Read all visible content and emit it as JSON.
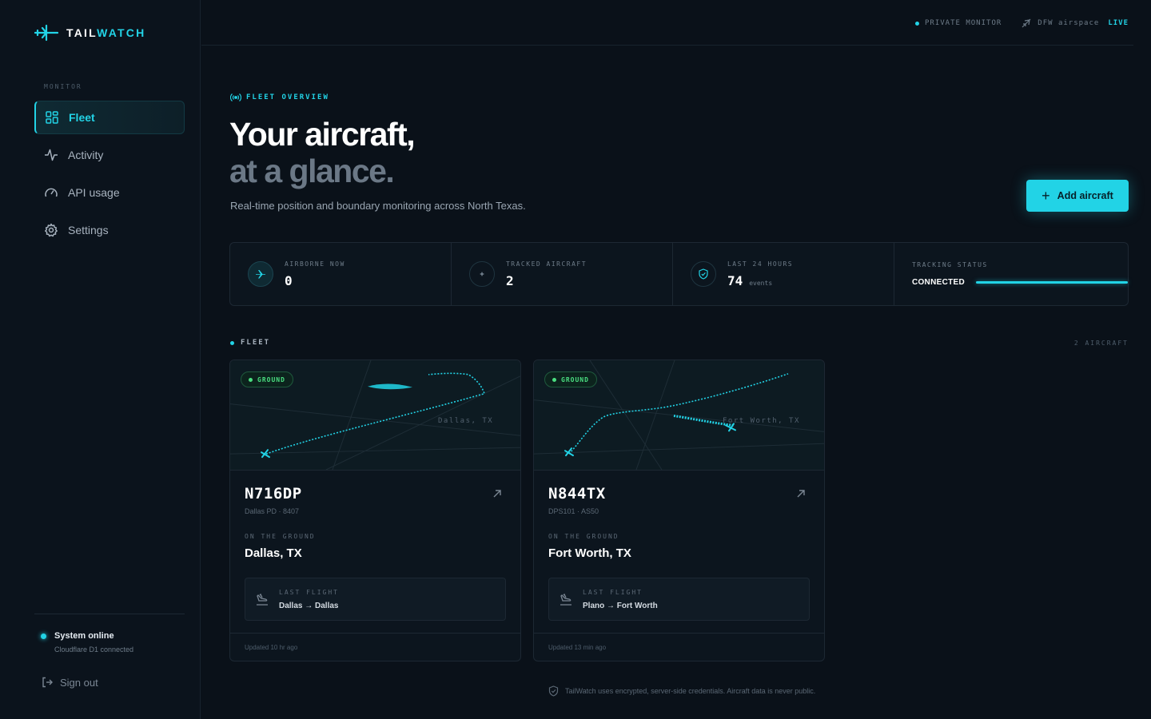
{
  "brand": {
    "name_a": "TAIL",
    "name_b": "WATCH",
    "icon": "plane-icon"
  },
  "sidebar": {
    "section_label": "MONITOR",
    "items": [
      {
        "label": "Fleet",
        "icon": "grid-icon",
        "active": true
      },
      {
        "label": "Activity",
        "icon": "activity-icon"
      },
      {
        "label": "API usage",
        "icon": "gauge-icon"
      },
      {
        "label": "Settings",
        "icon": "gear-icon"
      }
    ],
    "status_title": "System online",
    "status_sub": "Cloudflare D1 connected",
    "signout_label": "Sign out"
  },
  "topbar": {
    "private_label": "PRIVATE MONITOR",
    "airspace_label": "DFW airspace",
    "live_label": "LIVE"
  },
  "hero": {
    "eyebrow": "FLEET OVERVIEW",
    "title_line1": "Your aircraft,",
    "title_line2": "at a glance.",
    "subtitle": "Real-time position and boundary monitoring across North Texas.",
    "add_button": "Add aircraft"
  },
  "stats": {
    "airborne_label": "AIRBORNE NOW",
    "airborne_value": "0",
    "tracked_label": "TRACKED AIRCRAFT",
    "tracked_value": "2",
    "last24_label": "LAST 24 HOURS",
    "last24_value": "74",
    "last24_unit": "events",
    "tracking_label": "TRACKING STATUS",
    "tracking_value": "CONNECTED"
  },
  "fleet": {
    "label": "FLEET",
    "count": "2 AIRCRAFT",
    "cards": [
      {
        "badge": "GROUND",
        "map_city": "Dallas, TX",
        "tail": "N716DP",
        "model": "Dallas PD · 8407",
        "state_label": "ON THE GROUND",
        "location": "Dallas, TX",
        "last_flight_label": "LAST FLIGHT",
        "last_flight_route": "Dallas → Dallas",
        "updated": "Updated 10 hr ago"
      },
      {
        "badge": "GROUND",
        "map_city": "Fort Worth, TX",
        "tail": "N844TX",
        "model": "DPS101 · AS50",
        "state_label": "ON THE GROUND",
        "location": "Fort Worth, TX",
        "last_flight_label": "LAST FLIGHT",
        "last_flight_route": "Plano → Fort Worth",
        "updated": "Updated 13 min ago"
      }
    ]
  },
  "footnote": "TailWatch uses encrypted, server-side credentials. Aircraft data is never public.",
  "colors": {
    "accent": "#22d3e6",
    "ground": "#4ade80",
    "bg": "#0a1119"
  }
}
